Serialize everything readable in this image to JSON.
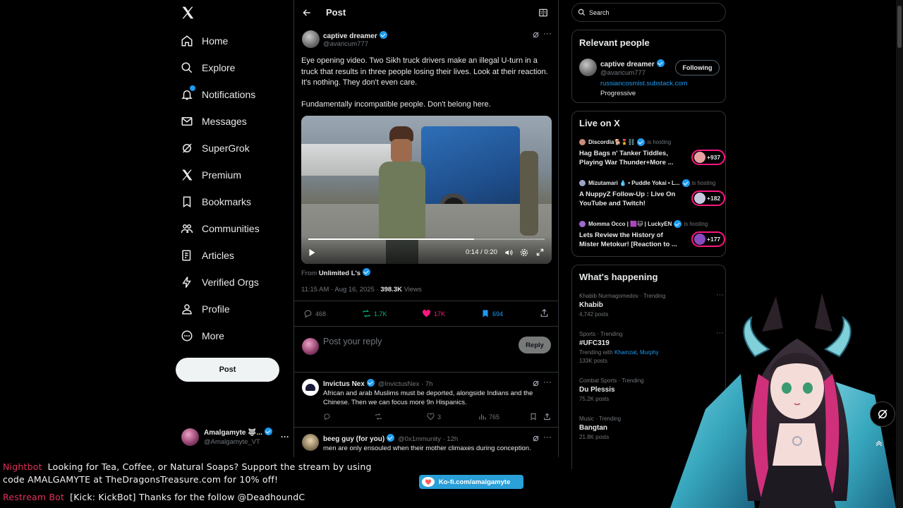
{
  "nav": {
    "items": [
      {
        "label": "Home",
        "icon": "home-icon"
      },
      {
        "label": "Explore",
        "icon": "search-icon"
      },
      {
        "label": "Notifications",
        "icon": "bell-icon"
      },
      {
        "label": "Messages",
        "icon": "envelope-icon"
      },
      {
        "label": "SuperGrok",
        "icon": "grok-icon"
      },
      {
        "label": "Premium",
        "icon": "x-logo-icon"
      },
      {
        "label": "Bookmarks",
        "icon": "bookmark-icon"
      },
      {
        "label": "Communities",
        "icon": "people-icon"
      },
      {
        "label": "Articles",
        "icon": "article-icon"
      },
      {
        "label": "Verified Orgs",
        "icon": "lightning-icon"
      },
      {
        "label": "Profile",
        "icon": "person-icon"
      },
      {
        "label": "More",
        "icon": "more-circle-icon"
      }
    ],
    "post_button": "Post",
    "account": {
      "name": "Amalgamyte 🐺...",
      "handle": "@Amalgamyte_VT"
    }
  },
  "header": {
    "title": "Post"
  },
  "post": {
    "author": "captive dreamer",
    "handle": "@avaricum777",
    "text_p1": "Eye opening video.  Two Sikh truck drivers make an illegal U-turn in a truck that results in three people losing their lives.  Look at their reaction.  It's nothing.  They don't even care.",
    "text_p2": "Fundamentally incompatible people.  Don't belong here.",
    "video_time": "0:14 / 0:20",
    "video_progress": 0.7,
    "from_label": "From",
    "from_source": "Unlimited L's",
    "timestamp": "11:15 AM · Aug 16, 2025 · ",
    "views": "398.3K",
    "views_label": " Views",
    "replies": "468",
    "reposts": "1.7K",
    "likes": "17K",
    "bookmarks": "694"
  },
  "reply_box": {
    "placeholder": "Post your reply",
    "button": "Reply"
  },
  "replies": [
    {
      "author": "Invictus Nex",
      "handle": "@InvictusNex · 7h",
      "text": "African and arab Muslims must be deported, alongside Indians and the Chinese. Then we can focus more 9n Hispanics.",
      "likes": "3",
      "views": "765"
    },
    {
      "author": "beeg guy (for you)",
      "handle": "@0x1mmunity · 12h",
      "text": "men are only ensouled when their mother climaxes during conception."
    }
  ],
  "search": {
    "placeholder": "Search"
  },
  "relevant": {
    "title": "Relevant people",
    "name": "captive dreamer",
    "handle": "@avaricum777",
    "button": "Following",
    "link": "russiancosmist.substack.com",
    "bio": "Progressive"
  },
  "live": {
    "title": "Live on X",
    "items": [
      {
        "host": "Discordia🐕🎖️⛓️",
        "hosting": "is hosting",
        "title_l1": "Hag Bags n' Tanker Tiddles,",
        "title_l2": "Playing War Thunder+More ...",
        "count": "+937"
      },
      {
        "host": "Mizutamari 💧 • Puddle Yokai • L...",
        "hosting": "is hosting",
        "title_l1": "A NuppyZ Follow-Up : Live On",
        "title_l2": "YouTube and Twitch!",
        "count": "+182"
      },
      {
        "host": "Momma Occo | 🟪🐱 | LuckyEN",
        "hosting": "is hosting",
        "title_l1": "Lets Review the History of",
        "title_l2": "Mister Metokur! [Reaction to ...",
        "count": "+177"
      }
    ]
  },
  "happening": {
    "title": "What's happening",
    "trends": [
      {
        "category": "Khabib Nurmagomedov · Trending",
        "name": "Khabib",
        "count": "4,742 posts"
      },
      {
        "category": "Sports · Trending",
        "name": "#UFC319",
        "with_label": "Trending with ",
        "with_names": "Khamzat, Murphy",
        "count": "133K posts"
      },
      {
        "category": "Combat Sports · Trending",
        "name": "Du Plessis",
        "count": "75.2K posts"
      },
      {
        "category": "Music · Trending",
        "name": "Bangtan",
        "count": "21.8K posts"
      }
    ]
  },
  "overlay": {
    "chat": [
      {
        "who": "Nightbot",
        "text": "Looking for Tea, Coffee, or Natural Soaps? Support the stream by using"
      },
      {
        "who": "",
        "text": "code AMALGAMYTE at TheDragonsTreasure.com for 10% off!"
      },
      {
        "who": "Restream Bot",
        "text": "[Kick: KickBot] Thanks for the follow @DeadhoundC"
      }
    ],
    "kofi": "Ko-fi.com/amalgamyte"
  },
  "colors": {
    "accent": "#1d9bf0",
    "like": "#f91880",
    "repost": "#00ba7c",
    "border": "#2f3336"
  }
}
